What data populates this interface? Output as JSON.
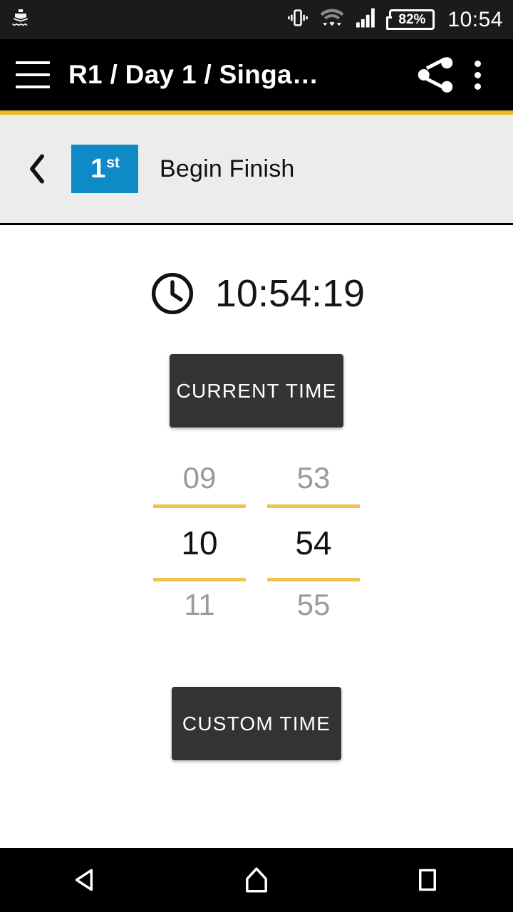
{
  "status_bar": {
    "notification_icon": "ship-icon",
    "icons": [
      "vibrate-icon",
      "wifi-icon",
      "cellular-signal-icon"
    ],
    "battery_level": "82%",
    "clock": "10:54"
  },
  "app_bar": {
    "menu_icon": "hamburger-menu-icon",
    "title": "R1 / Day 1 / Singa…",
    "share_icon": "share-icon",
    "overflow_icon": "more-vertical-icon"
  },
  "sub_header": {
    "back_icon": "chevron-left-icon",
    "rank_number": "1",
    "rank_suffix": "st",
    "label": "Begin Finish",
    "badge_color": "#0E8AC6",
    "background": "#ECECEC"
  },
  "accent_color": "#EFB81B",
  "main": {
    "clock_icon": "clock-icon",
    "clock_value": "10:54:19",
    "current_time_button": "CURRENT TIME",
    "custom_time_button": "CUSTOM TIME",
    "picker": {
      "hours": {
        "previous": "09",
        "selected": "10",
        "next": "11"
      },
      "minutes": {
        "previous": "53",
        "selected": "54",
        "next": "55"
      },
      "rule_color": "#EFC24D"
    }
  },
  "nav_bar": {
    "back_icon": "nav-back-triangle-icon",
    "home_icon": "nav-home-icon",
    "recents_icon": "nav-recents-square-icon"
  }
}
